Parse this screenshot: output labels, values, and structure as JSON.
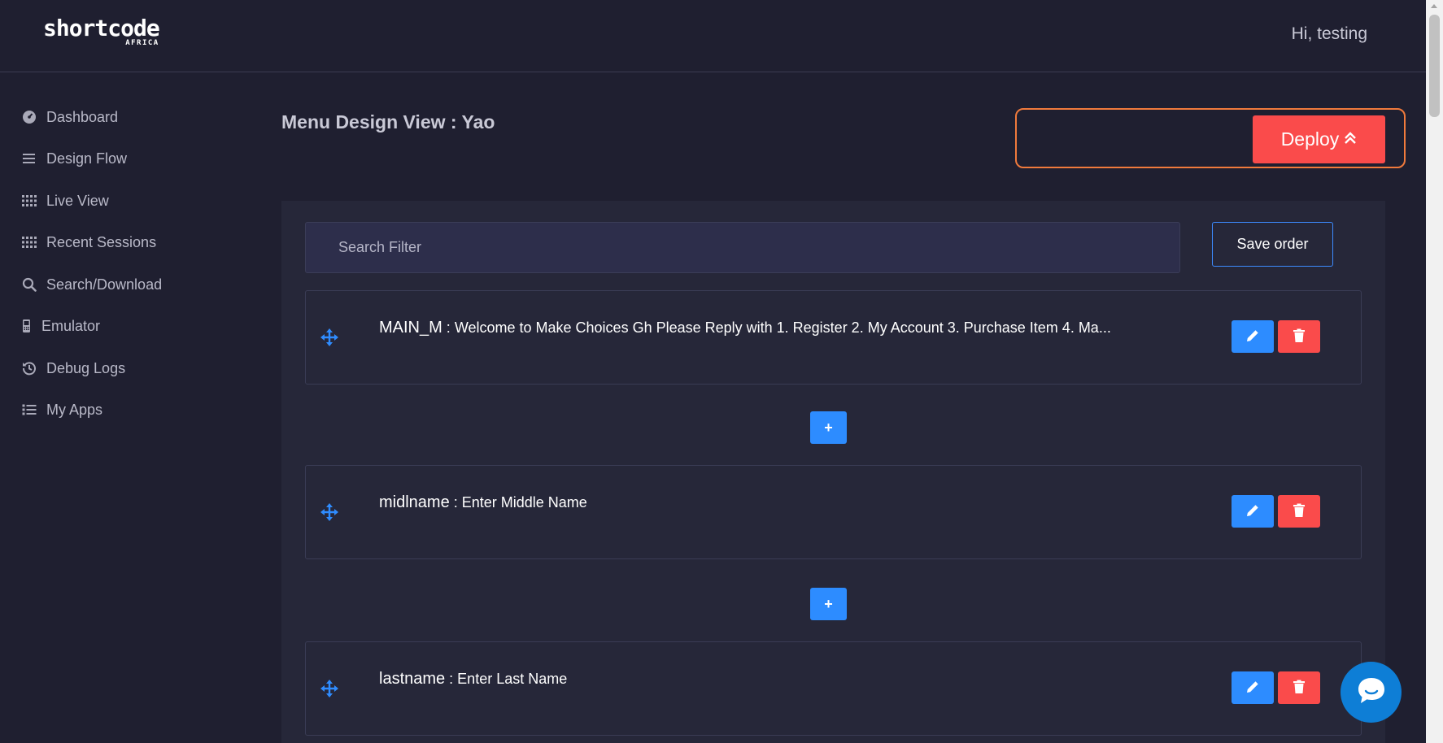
{
  "header": {
    "logo_main": "shortcode",
    "logo_sub": "AFRICA",
    "greeting": "Hi, testing"
  },
  "sidebar": {
    "items": [
      {
        "label": "Dashboard",
        "icon": "dashboard-icon"
      },
      {
        "label": "Design Flow",
        "icon": "bars-icon"
      },
      {
        "label": "Live View",
        "icon": "grid-icon"
      },
      {
        "label": "Recent Sessions",
        "icon": "grid-icon"
      },
      {
        "label": "Search/Download",
        "icon": "search-icon"
      },
      {
        "label": "Emulator",
        "icon": "phone-icon"
      },
      {
        "label": "Debug Logs",
        "icon": "history-icon"
      },
      {
        "label": "My Apps",
        "icon": "list-icon"
      }
    ]
  },
  "main": {
    "title": "Menu Design View : Yao",
    "deploy_label": "Deploy",
    "search_placeholder": "Search Filter",
    "save_order_label": "Save order",
    "add_label": "+",
    "menus": [
      {
        "key": "MAIN_M",
        "separator": " : ",
        "text": "Welcome to Make Choices Gh Please Reply with 1. Register 2. My Account 3. Purchase Item 4. Ma..."
      },
      {
        "key": "midlname",
        "separator": " : ",
        "text": "Enter Middle Name"
      },
      {
        "key": "lastname",
        "separator": " : ",
        "text": "Enter Last Name"
      }
    ]
  },
  "colors": {
    "background": "#1f1f30",
    "panel": "#262739",
    "accent_blue": "#2d8cff",
    "danger_red": "#fa4b4b",
    "deploy_border": "#f07a3c",
    "chat": "#0e7ed6"
  }
}
